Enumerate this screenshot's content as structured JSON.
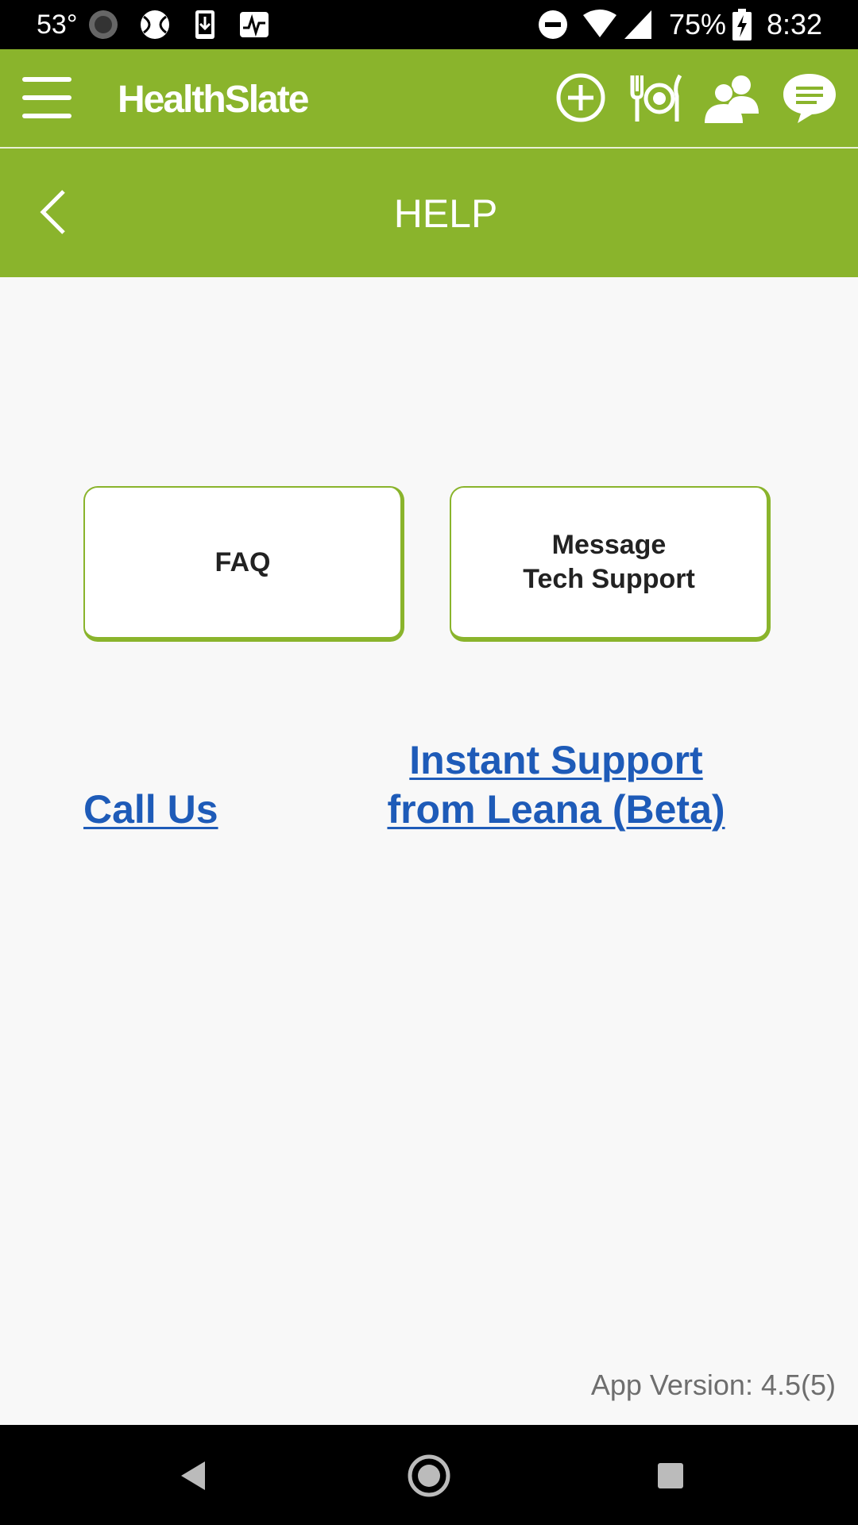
{
  "status_bar": {
    "temperature": "53°",
    "battery": "75%",
    "time": "8:32",
    "icons": [
      "sun-icon",
      "sports-ball-icon",
      "download-icon",
      "activity-icon",
      "do-not-disturb-icon",
      "wifi-icon",
      "cell-signal-icon",
      "battery-charging-icon"
    ]
  },
  "app_bar": {
    "brand": "HealthSlate",
    "icons": [
      "menu-icon",
      "add-icon",
      "meal-icon",
      "community-icon",
      "chat-icon"
    ]
  },
  "title_bar": {
    "title": "HELP"
  },
  "buttons": {
    "faq": "FAQ",
    "message_tech_support": "Message\nTech Support"
  },
  "links": {
    "call_us": "Call Us",
    "instant_support_line1": "Instant Support",
    "instant_support_line2": "from Leana (Beta)"
  },
  "footer": {
    "app_version": "App Version: 4.5(5)"
  },
  "colors": {
    "brand_green": "#8ab42c",
    "link_blue": "#1e5bb8",
    "background": "#f8f8f8"
  }
}
